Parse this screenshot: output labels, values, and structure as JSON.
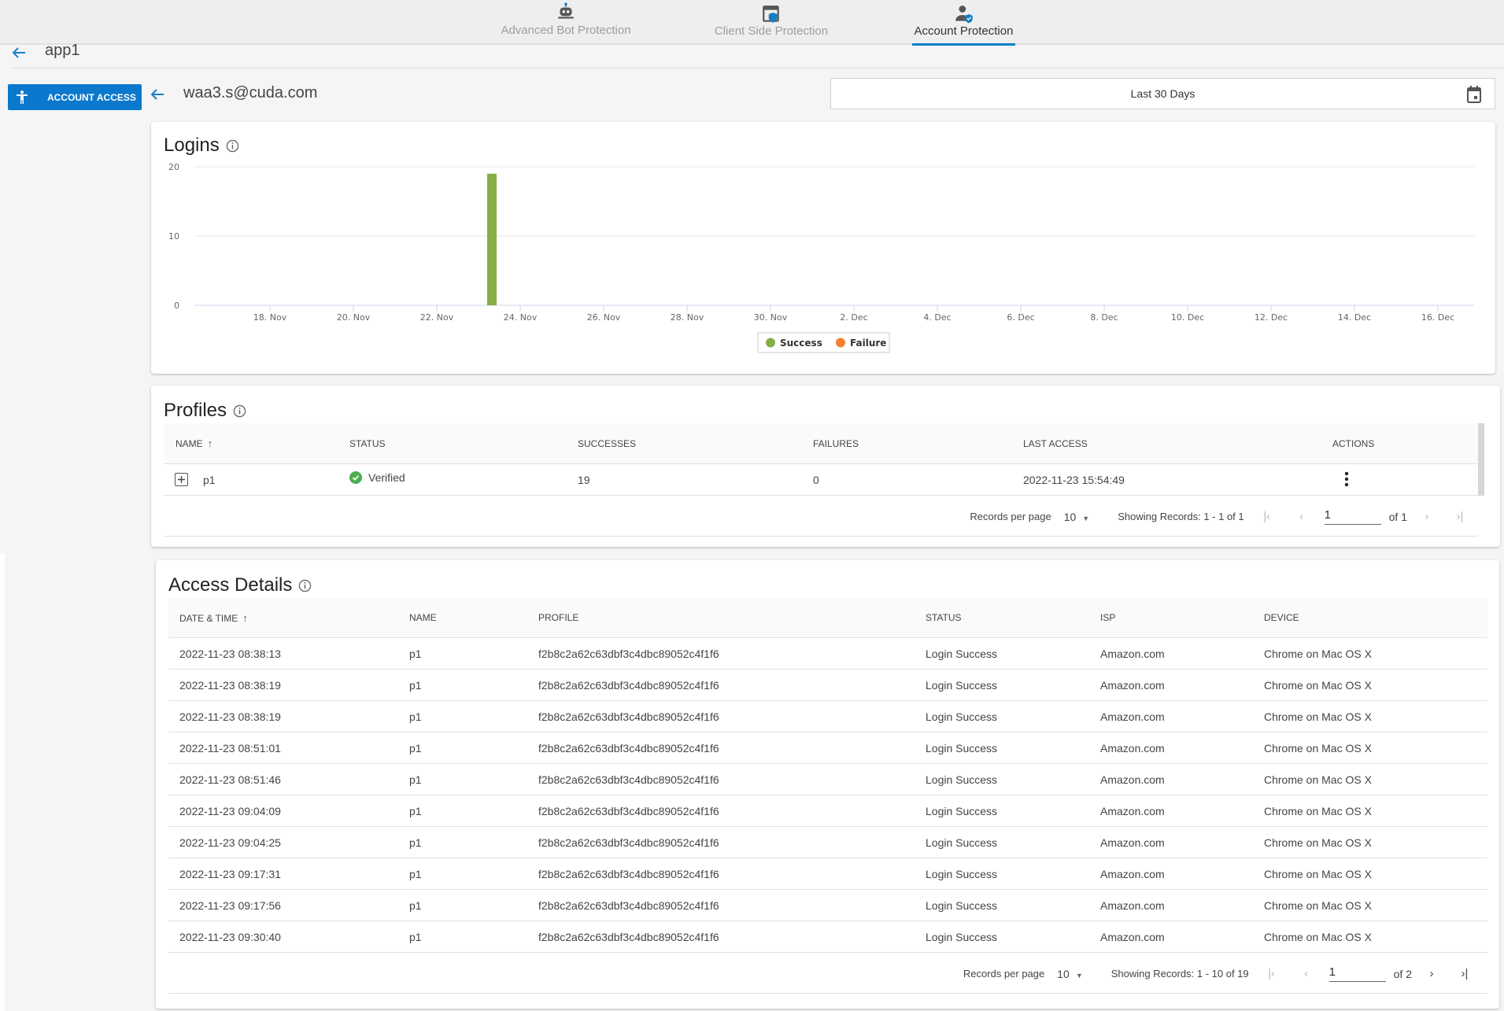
{
  "nav": {
    "tabs": [
      {
        "label": "Advanced Bot Protection",
        "icon": "robot-icon",
        "active": false
      },
      {
        "label": "Client Side Protection",
        "icon": "browser-shield-icon",
        "active": false
      },
      {
        "label": "Account Protection",
        "icon": "user-shield-icon",
        "active": true
      }
    ]
  },
  "header": {
    "app_name": "app1",
    "account_access_label": "ACCOUNT ACCESS",
    "user_email": "waa3.s@cuda.com",
    "date_range": "Last 30 Days"
  },
  "colors": {
    "accent": "#0a78cc",
    "success": "#86ae47",
    "failure": "#f7802f",
    "verified": "#4caf50"
  },
  "logins": {
    "title": "Logins"
  },
  "chart_data": {
    "type": "bar",
    "title": "Logins",
    "xlabel": "",
    "ylabel": "",
    "ylim": [
      0,
      20
    ],
    "yticks": [
      "0",
      "10",
      "20"
    ],
    "x_range_days": [
      "2022-11-16",
      "2022-12-17"
    ],
    "xtick_labels": [
      "18. Nov",
      "20. Nov",
      "22. Nov",
      "24. Nov",
      "26. Nov",
      "28. Nov",
      "30. Nov",
      "2. Dec",
      "4. Dec",
      "6. Dec",
      "8. Dec",
      "10. Dec",
      "12. Dec",
      "14. Dec",
      "16. Dec"
    ],
    "grid": true,
    "legend_position": "bottom-center",
    "series": [
      {
        "name": "Success",
        "color": "#86ae47",
        "points": [
          {
            "date": "2022-11-23",
            "value": 19
          }
        ]
      },
      {
        "name": "Failure",
        "color": "#f7802f",
        "points": []
      }
    ]
  },
  "profiles": {
    "title": "Profiles",
    "columns": [
      "NAME",
      "STATUS",
      "SUCCESSES",
      "FAILURES",
      "LAST ACCESS",
      "ACTIONS"
    ],
    "rows": [
      {
        "name": "p1",
        "status": "Verified",
        "successes": "19",
        "failures": "0",
        "last_access": "2022-11-23 15:54:49"
      }
    ],
    "pager": {
      "records_per_page_label": "Records per page",
      "records_per_page": "10",
      "showing": "Showing Records: 1 - 1 of 1",
      "page": "1",
      "of": "of 1"
    }
  },
  "access_details": {
    "title": "Access Details",
    "columns": [
      "DATE & TIME",
      "NAME",
      "PROFILE",
      "STATUS",
      "ISP",
      "DEVICE"
    ],
    "rows": [
      {
        "datetime": "2022-11-23 08:38:13",
        "name": "p1",
        "profile": "f2b8c2a62c63dbf3c4dbc89052c4f1f6",
        "status": "Login Success",
        "isp": "Amazon.com",
        "device": "Chrome on Mac OS X"
      },
      {
        "datetime": "2022-11-23 08:38:19",
        "name": "p1",
        "profile": "f2b8c2a62c63dbf3c4dbc89052c4f1f6",
        "status": "Login Success",
        "isp": "Amazon.com",
        "device": "Chrome on Mac OS X"
      },
      {
        "datetime": "2022-11-23 08:38:19",
        "name": "p1",
        "profile": "f2b8c2a62c63dbf3c4dbc89052c4f1f6",
        "status": "Login Success",
        "isp": "Amazon.com",
        "device": "Chrome on Mac OS X"
      },
      {
        "datetime": "2022-11-23 08:51:01",
        "name": "p1",
        "profile": "f2b8c2a62c63dbf3c4dbc89052c4f1f6",
        "status": "Login Success",
        "isp": "Amazon.com",
        "device": "Chrome on Mac OS X"
      },
      {
        "datetime": "2022-11-23 08:51:46",
        "name": "p1",
        "profile": "f2b8c2a62c63dbf3c4dbc89052c4f1f6",
        "status": "Login Success",
        "isp": "Amazon.com",
        "device": "Chrome on Mac OS X"
      },
      {
        "datetime": "2022-11-23 09:04:09",
        "name": "p1",
        "profile": "f2b8c2a62c63dbf3c4dbc89052c4f1f6",
        "status": "Login Success",
        "isp": "Amazon.com",
        "device": "Chrome on Mac OS X"
      },
      {
        "datetime": "2022-11-23 09:04:25",
        "name": "p1",
        "profile": "f2b8c2a62c63dbf3c4dbc89052c4f1f6",
        "status": "Login Success",
        "isp": "Amazon.com",
        "device": "Chrome on Mac OS X"
      },
      {
        "datetime": "2022-11-23 09:17:31",
        "name": "p1",
        "profile": "f2b8c2a62c63dbf3c4dbc89052c4f1f6",
        "status": "Login Success",
        "isp": "Amazon.com",
        "device": "Chrome on Mac OS X"
      },
      {
        "datetime": "2022-11-23 09:17:56",
        "name": "p1",
        "profile": "f2b8c2a62c63dbf3c4dbc89052c4f1f6",
        "status": "Login Success",
        "isp": "Amazon.com",
        "device": "Chrome on Mac OS X"
      },
      {
        "datetime": "2022-11-23 09:30:40",
        "name": "p1",
        "profile": "f2b8c2a62c63dbf3c4dbc89052c4f1f6",
        "status": "Login Success",
        "isp": "Amazon.com",
        "device": "Chrome on Mac OS X"
      }
    ],
    "pager": {
      "records_per_page_label": "Records per page",
      "records_per_page": "10",
      "showing": "Showing Records: 1 - 10 of 19",
      "page": "1",
      "of": "of 2"
    }
  }
}
